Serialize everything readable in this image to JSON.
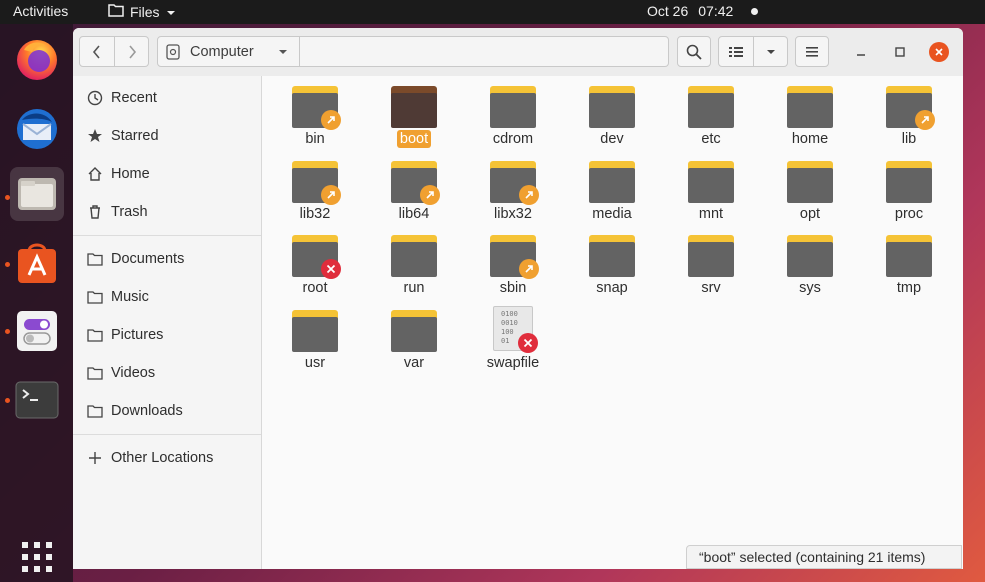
{
  "topbar": {
    "activities": "Activities",
    "app_menu": "Files",
    "date": "Oct 26",
    "time": "07:42"
  },
  "dock": {
    "items": [
      "firefox-icon",
      "thunderbird-icon",
      "files-icon",
      "software-icon",
      "settings-toggle-icon",
      "terminal-icon"
    ],
    "show_apps": "apps-grid-icon"
  },
  "headerbar": {
    "location": "Computer",
    "buttons": [
      "back-icon",
      "forward-icon",
      "search-icon",
      "list-view-icon",
      "view-dropdown-icon",
      "menu-icon",
      "minimize-icon",
      "maximize-icon",
      "close-icon"
    ]
  },
  "sidebar": {
    "places": [
      {
        "label": "Recent",
        "icon": "clock-icon"
      },
      {
        "label": "Starred",
        "icon": "star-icon"
      },
      {
        "label": "Home",
        "icon": "home-icon"
      },
      {
        "label": "Trash",
        "icon": "trash-icon"
      }
    ],
    "bookmarks": [
      {
        "label": "Documents",
        "icon": "folder-icon"
      },
      {
        "label": "Music",
        "icon": "folder-icon"
      },
      {
        "label": "Pictures",
        "icon": "folder-icon"
      },
      {
        "label": "Videos",
        "icon": "folder-icon"
      },
      {
        "label": "Downloads",
        "icon": "folder-icon"
      }
    ],
    "other": {
      "label": "Other Locations",
      "icon": "plus-icon"
    }
  },
  "files": [
    {
      "name": "bin",
      "type": "folder",
      "emblem": "link",
      "selected": false
    },
    {
      "name": "boot",
      "type": "folder",
      "emblem": "",
      "selected": true
    },
    {
      "name": "cdrom",
      "type": "folder",
      "emblem": "",
      "selected": false
    },
    {
      "name": "dev",
      "type": "folder",
      "emblem": "",
      "selected": false
    },
    {
      "name": "etc",
      "type": "folder",
      "emblem": "",
      "selected": false
    },
    {
      "name": "home",
      "type": "folder",
      "emblem": "",
      "selected": false
    },
    {
      "name": "lib",
      "type": "folder",
      "emblem": "link",
      "selected": false
    },
    {
      "name": "lib32",
      "type": "folder",
      "emblem": "link",
      "selected": false
    },
    {
      "name": "lib64",
      "type": "folder",
      "emblem": "link",
      "selected": false
    },
    {
      "name": "libx32",
      "type": "folder",
      "emblem": "link",
      "selected": false
    },
    {
      "name": "media",
      "type": "folder",
      "emblem": "",
      "selected": false
    },
    {
      "name": "mnt",
      "type": "folder",
      "emblem": "",
      "selected": false
    },
    {
      "name": "opt",
      "type": "folder",
      "emblem": "",
      "selected": false
    },
    {
      "name": "proc",
      "type": "folder",
      "emblem": "",
      "selected": false
    },
    {
      "name": "root",
      "type": "folder",
      "emblem": "noaccess",
      "selected": false
    },
    {
      "name": "run",
      "type": "folder",
      "emblem": "",
      "selected": false
    },
    {
      "name": "sbin",
      "type": "folder",
      "emblem": "link",
      "selected": false
    },
    {
      "name": "snap",
      "type": "folder",
      "emblem": "",
      "selected": false
    },
    {
      "name": "srv",
      "type": "folder",
      "emblem": "",
      "selected": false
    },
    {
      "name": "sys",
      "type": "folder",
      "emblem": "",
      "selected": false
    },
    {
      "name": "tmp",
      "type": "folder",
      "emblem": "",
      "selected": false
    },
    {
      "name": "usr",
      "type": "folder",
      "emblem": "",
      "selected": false
    },
    {
      "name": "var",
      "type": "folder",
      "emblem": "",
      "selected": false
    },
    {
      "name": "swapfile",
      "type": "binary",
      "emblem": "noaccess",
      "selected": false,
      "preview_text": [
        "0100",
        "0010",
        "100",
        "01"
      ]
    }
  ],
  "status": "“boot” selected  (containing 21 items)",
  "colors": {
    "accent": "#f0a030",
    "folder_tab": "#f5c336",
    "folder_body": "#636363",
    "noaccess": "#e02d3c"
  }
}
